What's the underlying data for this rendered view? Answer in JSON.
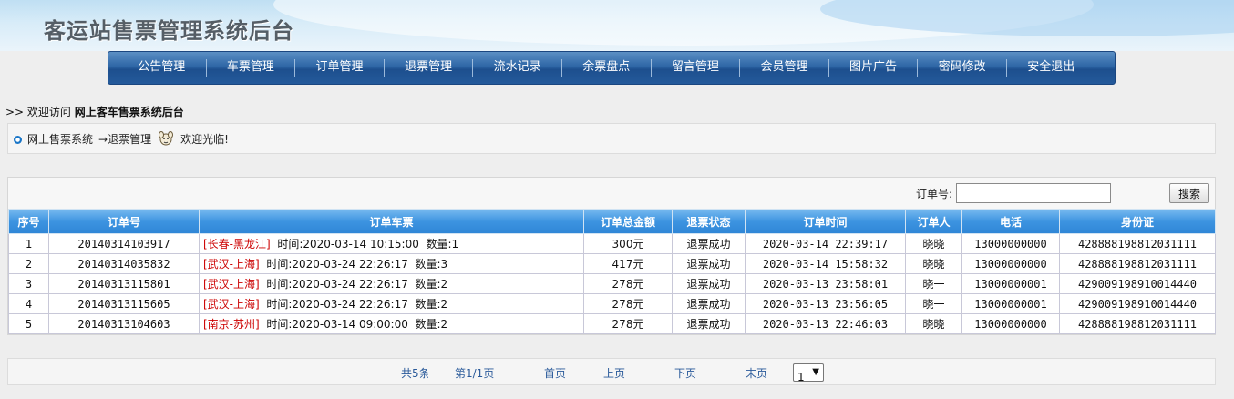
{
  "header": {
    "title": "客运站售票管理系统后台"
  },
  "nav": {
    "items": [
      "公告管理",
      "车票管理",
      "订单管理",
      "退票管理",
      "流水记录",
      "余票盘点",
      "留言管理",
      "会员管理",
      "图片广告",
      "密码修改",
      "安全退出"
    ]
  },
  "welcome": {
    "prefix": ">> 欢迎访问",
    "site_name": "网上客车售票系统后台"
  },
  "breadcrumb": {
    "system": "网上售票系统",
    "arrow_section": "→退票管理",
    "greeting": "欢迎光临!"
  },
  "search": {
    "label": "订单号:",
    "value": "",
    "button": "搜索"
  },
  "table": {
    "headers": [
      "序号",
      "订单号",
      "订单车票",
      "订单总金额",
      "退票状态",
      "订单时间",
      "订单人",
      "电话",
      "身份证"
    ],
    "rows": [
      {
        "no": "1",
        "order_id": "20140314103917",
        "route": "[长春-黑龙江]",
        "time_label": "时间:2020-03-14 10:15:00",
        "qty_label": "数量:1",
        "amount": "300元",
        "status": "退票成功",
        "order_time": "2020-03-14 22:39:17",
        "person": "晓晓",
        "phone": "13000000000",
        "id_card": "428888198812031111"
      },
      {
        "no": "2",
        "order_id": "20140314035832",
        "route": "[武汉-上海]",
        "time_label": "时间:2020-03-24 22:26:17",
        "qty_label": "数量:3",
        "amount": "417元",
        "status": "退票成功",
        "order_time": "2020-03-14 15:58:32",
        "person": "晓晓",
        "phone": "13000000000",
        "id_card": "428888198812031111"
      },
      {
        "no": "3",
        "order_id": "20140313115801",
        "route": "[武汉-上海]",
        "time_label": "时间:2020-03-24 22:26:17",
        "qty_label": "数量:2",
        "amount": "278元",
        "status": "退票成功",
        "order_time": "2020-03-13 23:58:01",
        "person": "晓一",
        "phone": "13000000001",
        "id_card": "429009198910014440"
      },
      {
        "no": "4",
        "order_id": "20140313115605",
        "route": "[武汉-上海]",
        "time_label": "时间:2020-03-24 22:26:17",
        "qty_label": "数量:2",
        "amount": "278元",
        "status": "退票成功",
        "order_time": "2020-03-13 23:56:05",
        "person": "晓一",
        "phone": "13000000001",
        "id_card": "429009198910014440"
      },
      {
        "no": "5",
        "order_id": "20140313104603",
        "route": "[南京-苏州]",
        "time_label": "时间:2020-03-14 09:00:00",
        "qty_label": "数量:2",
        "amount": "278元",
        "status": "退票成功",
        "order_time": "2020-03-13 22:46:03",
        "person": "晓晓",
        "phone": "13000000000",
        "id_card": "428888198812031111"
      }
    ]
  },
  "pager": {
    "total": "共5条",
    "page_info": "第1/1页",
    "first": "首页",
    "prev": "上页",
    "next": "下页",
    "last": "末页",
    "selected_page": "1"
  },
  "colors": {
    "nav_bg": "#2e66a6",
    "table_header_bg": "#3c93e0",
    "route_text": "#cc0000",
    "pager_link": "#2a5a9a"
  },
  "icons": [
    "bullet-icon",
    "mascot-icon",
    "chevron-down-icon"
  ]
}
